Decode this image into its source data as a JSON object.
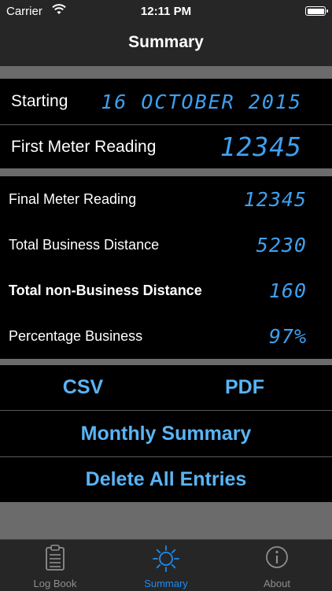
{
  "status": {
    "carrier": "Carrier",
    "time": "12:11 PM"
  },
  "nav": {
    "title": "Summary"
  },
  "header": {
    "starting_label": "Starting",
    "starting_value": "16 OCTOBER 2015",
    "first_reading_label": "First Meter Reading",
    "first_reading_value": "12345"
  },
  "stats": [
    {
      "label": "Final Meter Reading",
      "value": "12345"
    },
    {
      "label": "Total Business Distance",
      "value": "5230"
    },
    {
      "label": "Total non-Business Distance",
      "value": "160"
    },
    {
      "label": "Percentage Business",
      "value": "97%"
    }
  ],
  "actions": {
    "csv": "CSV",
    "pdf": "PDF",
    "monthly": "Monthly Summary",
    "delete": "Delete All Entries"
  },
  "tabs": [
    {
      "label": "Log Book",
      "icon": "clipboard-icon"
    },
    {
      "label": "Summary",
      "icon": "sun-icon"
    },
    {
      "label": "About",
      "icon": "info-icon"
    }
  ],
  "colors": {
    "lcd": "#3ea0f0",
    "button": "#5ab4f6",
    "tab_active": "#1e8cf0"
  }
}
